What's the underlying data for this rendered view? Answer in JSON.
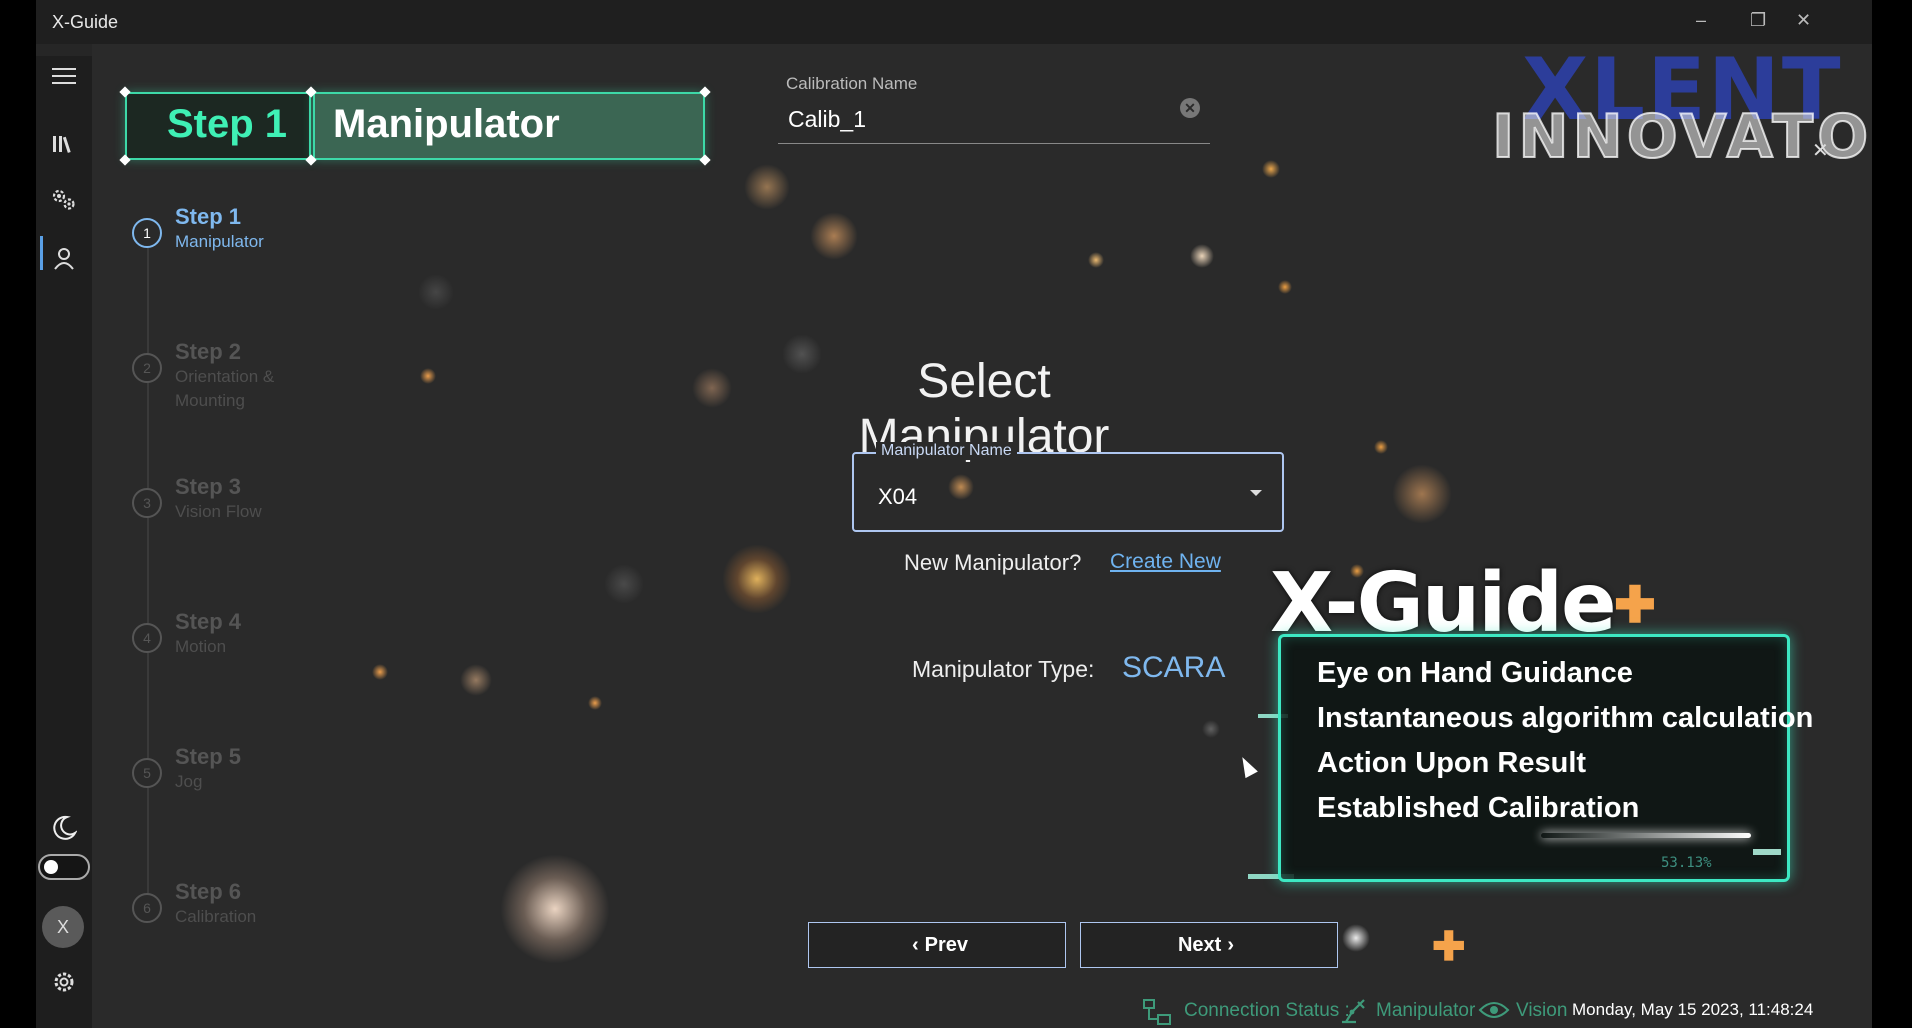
{
  "app": {
    "title": "X-Guide"
  },
  "brand": {
    "line1": "XLENT",
    "line2": "INNOVATOR"
  },
  "banner": {
    "step": "Step 1",
    "title": "Manipulator"
  },
  "calibration": {
    "label": "Calibration Name",
    "value": "Calib_1"
  },
  "steps": [
    {
      "num": "1",
      "title": "Step 1",
      "subtitle": "Manipulator"
    },
    {
      "num": "2",
      "title": "Step 2",
      "subtitle": "Orientation & Mounting"
    },
    {
      "num": "3",
      "title": "Step 3",
      "subtitle": "Vision Flow"
    },
    {
      "num": "4",
      "title": "Step 4",
      "subtitle": "Motion"
    },
    {
      "num": "5",
      "title": "Step 5",
      "subtitle": "Jog"
    },
    {
      "num": "6",
      "title": "Step 6",
      "subtitle": "Calibration"
    }
  ],
  "main": {
    "heading": "Select Manipulator",
    "manipulator_name_label": "Manipulator Name",
    "manipulator_name_value": "X04",
    "new_manipulator_text": "New Manipulator?",
    "create_new_link": "Create New",
    "type_label": "Manipulator Type:",
    "type_value": "SCARA"
  },
  "buttons": {
    "prev": "Prev",
    "next": "Next"
  },
  "promo": {
    "title": "X-Guide",
    "lines": [
      "Eye on Hand Guidance",
      "Instantaneous algorithm calculation",
      "Action Upon Result",
      "Established Calibration"
    ],
    "percent": "53.13%"
  },
  "sidebar": {
    "avatar_initial": "X"
  },
  "status": {
    "connection": "Connection Status :",
    "manipulator": "Manipulator",
    "vision": "Vision",
    "datetime": "Monday, May 15 2023, 11:48:24"
  },
  "colors": {
    "accent_teal": "#3dd9a8",
    "accent_blue": "#7fb8ee",
    "status_green": "#3e9a7a",
    "promo_orange": "#f5a34b"
  },
  "icons": [
    "menu-icon",
    "library-icon",
    "settings-gears-icon",
    "user-icon",
    "moon-icon",
    "gear-icon",
    "close-icon",
    "chevron-down-icon",
    "chevron-left-icon",
    "chevron-right-icon",
    "network-icon",
    "robot-arm-icon",
    "eye-icon"
  ]
}
